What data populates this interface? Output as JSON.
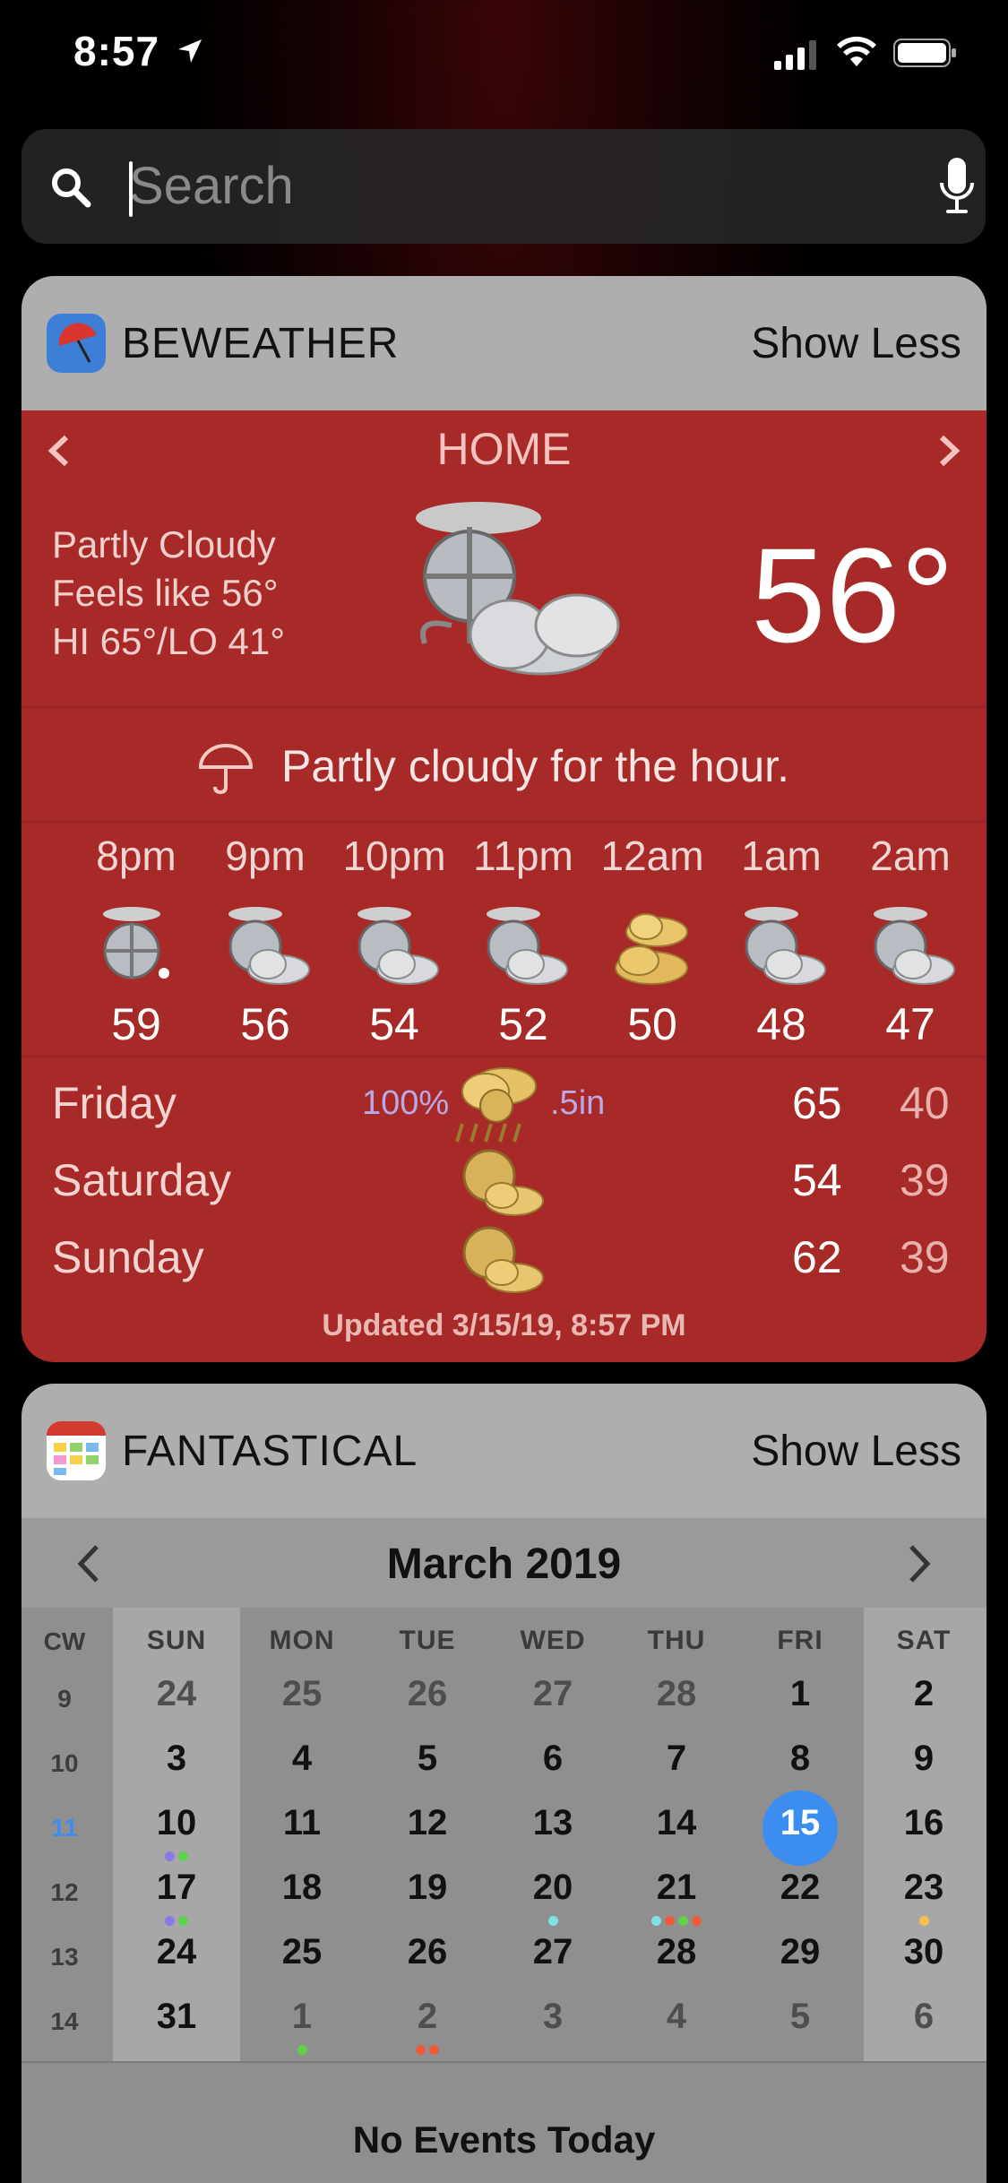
{
  "status_bar": {
    "time": "8:57"
  },
  "search": {
    "placeholder": "Search"
  },
  "beweather": {
    "app_name": "BEWEATHER",
    "show_less": "Show Less",
    "location": "HOME",
    "condition": "Partly Cloudy",
    "feels_like": "Feels like 56°",
    "hi_lo": "HI 65°/LO 41°",
    "temperature": "56°",
    "hour_summary": "Partly cloudy for the hour.",
    "hourly": [
      {
        "time": "8pm",
        "temp": "59",
        "icon": "moon-icon"
      },
      {
        "time": "9pm",
        "temp": "56",
        "icon": "partly-cloudy-icon"
      },
      {
        "time": "10pm",
        "temp": "54",
        "icon": "partly-cloudy-icon"
      },
      {
        "time": "11pm",
        "temp": "52",
        "icon": "partly-cloudy-icon"
      },
      {
        "time": "12am",
        "temp": "50",
        "icon": "cloudy-icon"
      },
      {
        "time": "1am",
        "temp": "48",
        "icon": "partly-cloudy-icon"
      },
      {
        "time": "2am",
        "temp": "47",
        "icon": "partly-cloudy-icon"
      }
    ],
    "daily": [
      {
        "day": "Friday",
        "precip": "100%",
        "amount": ".5in",
        "hi": "65",
        "lo": "40",
        "icon": "rain-icon"
      },
      {
        "day": "Saturday",
        "precip": "",
        "amount": "",
        "hi": "54",
        "lo": "39",
        "icon": "partly-cloudy-icon"
      },
      {
        "day": "Sunday",
        "precip": "",
        "amount": "",
        "hi": "62",
        "lo": "39",
        "icon": "partly-cloudy-icon"
      }
    ],
    "updated": "Updated 3/15/19, 8:57 PM",
    "colors": {
      "background": "#a82a28",
      "header": "#aeaeae"
    }
  },
  "fantastical": {
    "app_name": "FANTASTICAL",
    "show_less": "Show Less",
    "month_title": "March 2019",
    "cw_label": "CW",
    "weekdays": [
      "SUN",
      "MON",
      "TUE",
      "WED",
      "THU",
      "FRI",
      "SAT"
    ],
    "weeks": [
      {
        "cw": "9",
        "days": [
          "24",
          "25",
          "26",
          "27",
          "28",
          "1",
          "2"
        ]
      },
      {
        "cw": "10",
        "days": [
          "3",
          "4",
          "5",
          "6",
          "7",
          "8",
          "9"
        ]
      },
      {
        "cw": "11",
        "days": [
          "10",
          "11",
          "12",
          "13",
          "14",
          "15",
          "16"
        ]
      },
      {
        "cw": "12",
        "days": [
          "17",
          "18",
          "19",
          "20",
          "21",
          "22",
          "23"
        ]
      },
      {
        "cw": "13",
        "days": [
          "24",
          "25",
          "26",
          "27",
          "28",
          "29",
          "30"
        ]
      },
      {
        "cw": "14",
        "days": [
          "31",
          "1",
          "2",
          "3",
          "4",
          "5",
          "6"
        ]
      }
    ],
    "today": "15",
    "no_events": "No Events Today",
    "colors": {
      "today": "#3b8ef0",
      "current_week": "#3b8ef0"
    }
  }
}
